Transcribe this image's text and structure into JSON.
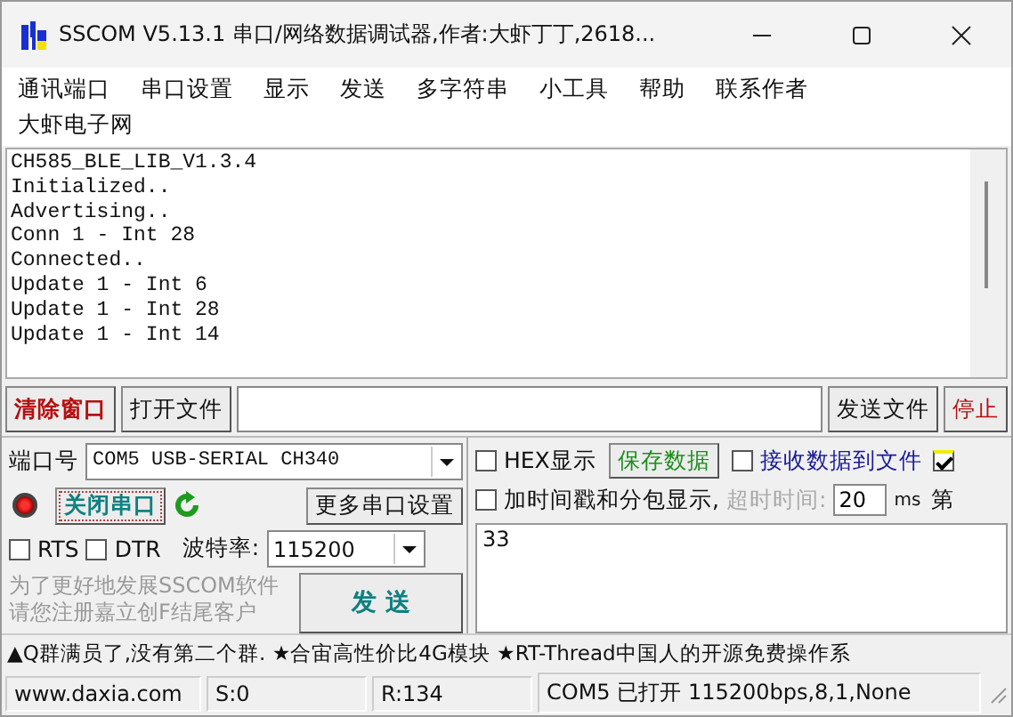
{
  "window": {
    "title": "SSCOM V5.13.1 串口/网络数据调试器,作者:大虾丁丁,2618..."
  },
  "menu": [
    "通讯端口",
    "串口设置",
    "显示",
    "发送",
    "多字符串",
    "小工具",
    "帮助",
    "联系作者",
    "大虾电子网"
  ],
  "receive_log": [
    "CH585_BLE_LIB_V1.3.4",
    "Initialized..",
    "Advertising..",
    "Conn 1 - Int 28",
    "Connected..",
    "Update 1 - Int 6",
    "Update 1 - Int 28",
    "Update 1 - Int 14"
  ],
  "toolbar": {
    "clear_button": "清除窗口",
    "open_file_button": "打开文件",
    "send_file_button": "发送文件",
    "stop_button": "停止"
  },
  "port": {
    "label": "端口号",
    "value": "COM5 USB-SERIAL CH340",
    "open": true,
    "toggle_button": "关闭串口",
    "more_settings_button": "更多串口设置",
    "rts": {
      "label": "RTS",
      "checked": false
    },
    "dtr": {
      "label": "DTR",
      "checked": false
    },
    "baud_label": "波特率:",
    "baud": "115200"
  },
  "promo": [
    "为了更好地发展SSCOM软件",
    "请您注册嘉立创F结尾客户"
  ],
  "send_button": "发 送",
  "options": {
    "hex_display": {
      "label": "HEX显示",
      "checked": false
    },
    "save_button": "保存数据",
    "receive_to_file": {
      "label": "接收数据到文件",
      "checked": false
    },
    "extra_checkbox": {
      "checked": true
    },
    "timestamp": {
      "label": "加时间戳和分包显示,",
      "checked": false
    },
    "timeout_label": "超时时间:",
    "timeout_disabled": true,
    "timeout": "20",
    "timeout_unit": "ms",
    "column_cut": "第"
  },
  "send_text": "33",
  "ticker": "▲Q群满员了,没有第二个群. ★合宙高性价比4G模块 ★RT-Thread中国人的开源免费操作系",
  "status_bar": [
    "www.daxia.com",
    "S:0",
    "R:134",
    "COM5 已打开  115200bps,8,1,None"
  ]
}
